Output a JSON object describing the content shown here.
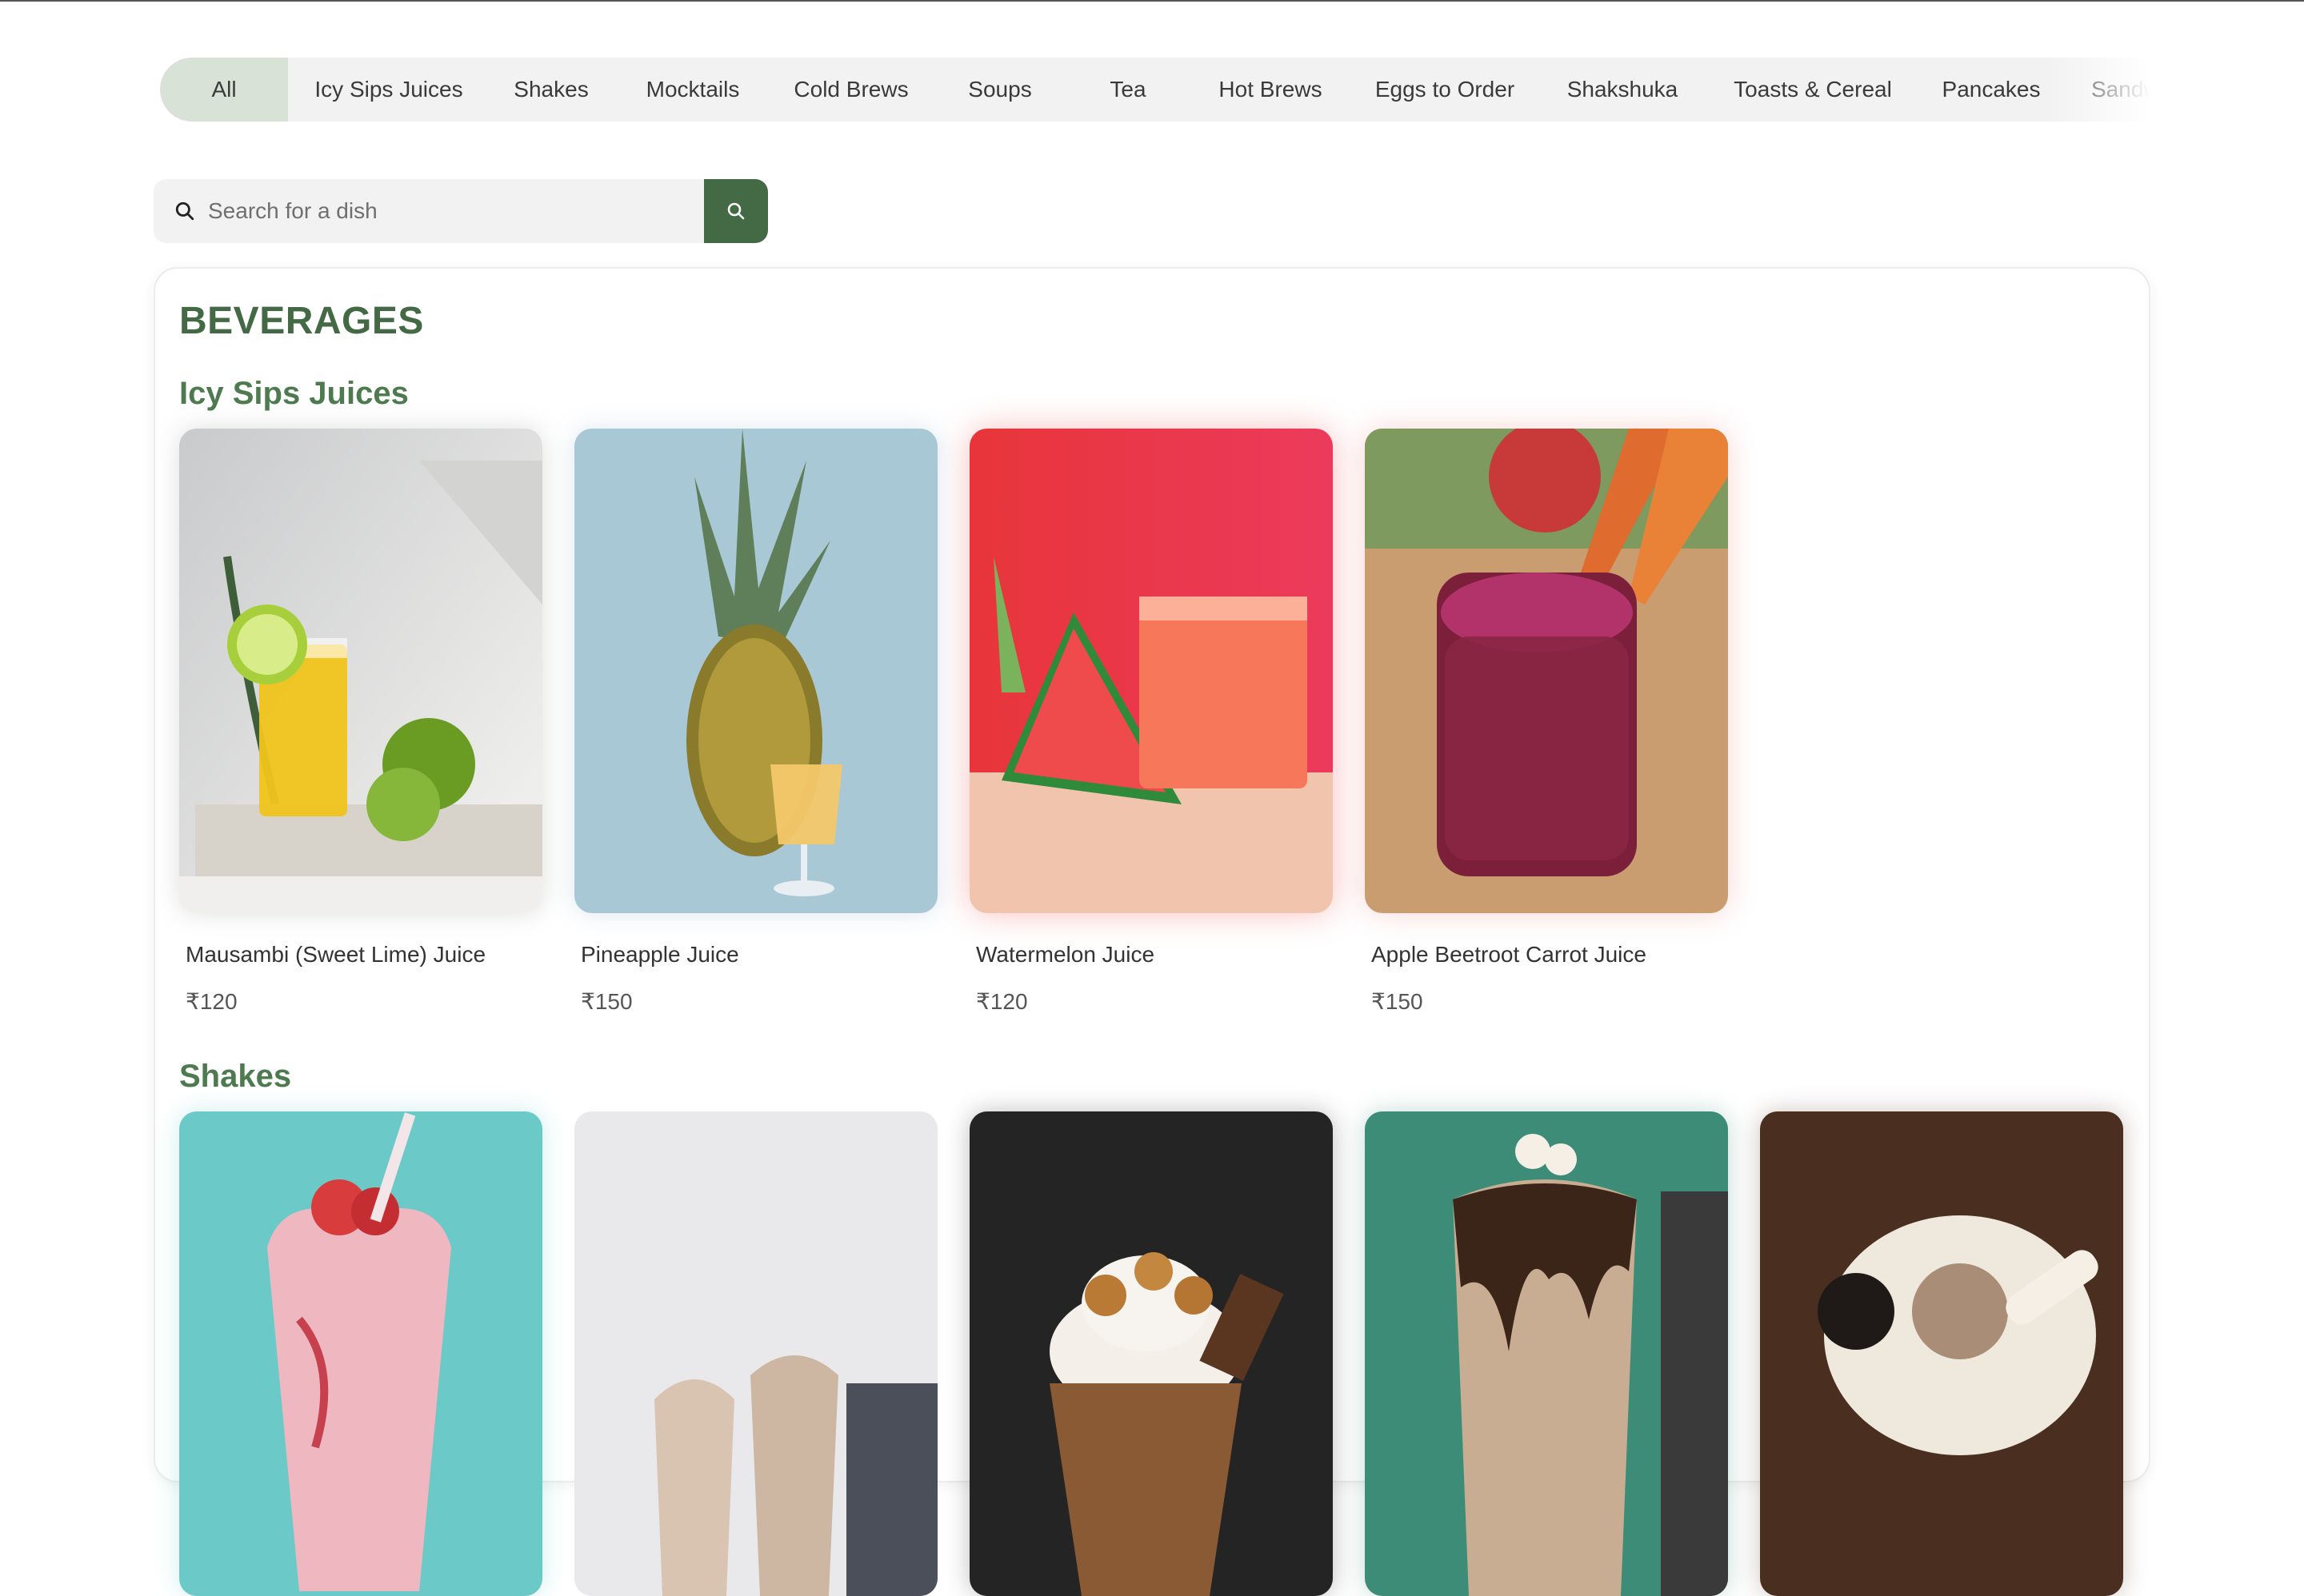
{
  "categories": [
    "All",
    "Icy Sips Juices",
    "Shakes",
    "Mocktails",
    "Cold Brews",
    "Soups",
    "Tea",
    "Hot Brews",
    "Eggs to Order",
    "Shakshuka",
    "Toasts & Cereal",
    "Pancakes",
    "Sandwiches"
  ],
  "active_category": "All",
  "search": {
    "placeholder": "Search for a dish"
  },
  "menu": {
    "section_title": "BEVERAGES",
    "groups": [
      {
        "title": "Icy Sips Juices",
        "items": [
          {
            "name": "Mausambi (Sweet Lime) Juice",
            "price": "₹120",
            "image": "sweet-lime-juice-photo"
          },
          {
            "name": "Pineapple Juice",
            "price": "₹150",
            "image": "pineapple-juice-photo"
          },
          {
            "name": "Watermelon Juice",
            "price": "₹120",
            "image": "watermelon-juice-photo"
          },
          {
            "name": "Apple Beetroot Carrot Juice",
            "price": "₹150",
            "image": "abc-juice-photo"
          }
        ]
      },
      {
        "title": "Shakes",
        "items": [
          {
            "image": "strawberry-shake-photo"
          },
          {
            "image": "vanilla-shake-photo"
          },
          {
            "image": "pretzel-shake-photo"
          },
          {
            "image": "chocolate-shake-photo"
          },
          {
            "image": "oreo-shake-photo"
          }
        ]
      }
    ]
  },
  "colors": {
    "brand_green": "#436a45",
    "heading_green": "#4d7a4f",
    "active_pill": "#d8e2d6"
  }
}
